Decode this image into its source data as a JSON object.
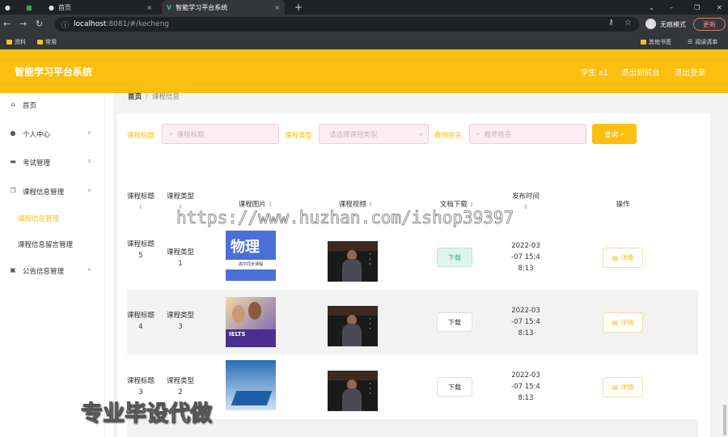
{
  "browser": {
    "tab_home": "首页",
    "tab_active": "智能学习平台系统",
    "close": "×",
    "new_tab": "+",
    "url_host": "localhost",
    "url_rest": ":8081/#/kecheng",
    "incognito": "无痕模式",
    "update_btn": "更新",
    "bookmarks": [
      "资料",
      "常用"
    ],
    "bookmarks_right": [
      "其他书签",
      "阅读清单"
    ]
  },
  "header": {
    "brand": "智能学习平台系统",
    "user": "学生 a1",
    "front": "退出到前台",
    "logout": "退出登录"
  },
  "menu": {
    "home": "首页",
    "personal": "个人中心",
    "exam": "考试管理",
    "course": "课程信息管理",
    "course_sub": [
      "课程信息管理",
      "课程信息留言管理"
    ],
    "notice": "公告信息管理"
  },
  "breadcrumb": {
    "home": "首页",
    "sep": "/",
    "current": "课程信息"
  },
  "search": {
    "title_label": "课程标题",
    "title_ph": "课程标题",
    "type_label": "课程类型",
    "type_ph": "请选择课程类型",
    "teacher_label": "教师姓名",
    "teacher_ph": "教师姓名",
    "query_btn": "查询"
  },
  "table": {
    "headers": [
      "课程标题",
      "课程类型",
      "课程图片",
      "课程视频",
      "文档下载",
      "发布时间",
      "操作"
    ],
    "rows": [
      {
        "title": "课程标题",
        "title_num": "5",
        "type": "课程类型",
        "type_num": "1",
        "download": "下载",
        "time1": "2022-03",
        "time2": "-07 15:4",
        "time3": "8:13",
        "detail": "详情",
        "cover_text": "物理",
        "cover_sub": "高中同步课程"
      },
      {
        "title": "课程标题",
        "title_num": "4",
        "type": "课程类型",
        "type_num": "3",
        "download": "下载",
        "time1": "2022-03",
        "time2": "-07 15:4",
        "time3": "8:13",
        "detail": "详情",
        "cover_text": "IELTS"
      },
      {
        "title": "课程标题",
        "title_num": "3",
        "type": "课程类型",
        "type_num": "2",
        "download": "下载",
        "time1": "2022-03",
        "time2": "-07 15:4",
        "time3": "8:13",
        "detail": "详情"
      }
    ]
  },
  "watermark": "https://www.huzhan.com/ishop39397",
  "promo": "专业毕设代做",
  "colors": {
    "accent": "#fcbf0f",
    "header_bg": "#fcbf0f",
    "input_bg": "#fdeef3"
  }
}
